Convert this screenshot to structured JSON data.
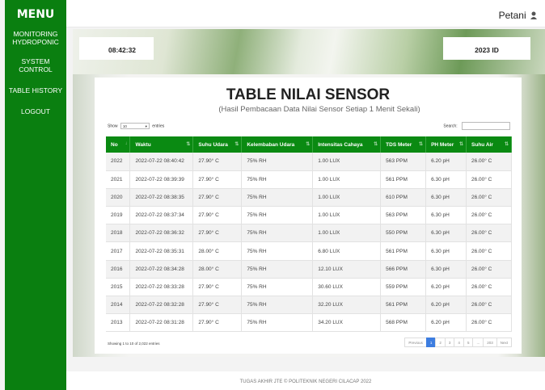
{
  "sidebar": {
    "brand": "MENU",
    "items": [
      {
        "line1": "MONITORING",
        "line2": "HYDROPONIC"
      },
      {
        "line1": "SYSTEM",
        "line2": "CONTROL"
      },
      {
        "line1": "TABLE HISTORY",
        "line2": ""
      },
      {
        "line1": "LOGOUT",
        "line2": ""
      }
    ]
  },
  "topbar": {
    "user": "Petani"
  },
  "hero": {
    "clock": "08:42:32",
    "id_label": "2023 ID"
  },
  "card": {
    "title": "TABLE NILAI SENSOR",
    "subtitle": "(Hasil Pembacaan Data Nilai Sensor Setiap 1 Menit Sekali)"
  },
  "controls": {
    "show_label": "Show",
    "length_value": "10",
    "entries_label": "entries",
    "search_label": "Search:"
  },
  "table": {
    "columns": [
      "No",
      "Waktu",
      "Suhu Udara",
      "Kelembaban Udara",
      "Intensitas Cahaya",
      "TDS Meter",
      "PH Meter",
      "Suhu Air"
    ],
    "rows": [
      [
        "2022",
        "2022-07-22 08:40:42",
        "27.90° C",
        "75% RH",
        "1.00 LUX",
        "563 PPM",
        "6.20 pH",
        "26.00° C"
      ],
      [
        "2021",
        "2022-07-22 08:39:39",
        "27.90° C",
        "75% RH",
        "1.00 LUX",
        "561 PPM",
        "6.30 pH",
        "26.00° C"
      ],
      [
        "2020",
        "2022-07-22 08:38:35",
        "27.90° C",
        "75% RH",
        "1.00 LUX",
        "610 PPM",
        "6.30 pH",
        "26.00° C"
      ],
      [
        "2019",
        "2022-07-22 08:37:34",
        "27.90° C",
        "75% RH",
        "1.00 LUX",
        "563 PPM",
        "6.30 pH",
        "26.00° C"
      ],
      [
        "2018",
        "2022-07-22 08:36:32",
        "27.90° C",
        "75% RH",
        "1.00 LUX",
        "550 PPM",
        "6.30 pH",
        "26.00° C"
      ],
      [
        "2017",
        "2022-07-22 08:35:31",
        "28.00° C",
        "75% RH",
        "6.80 LUX",
        "561 PPM",
        "6.30 pH",
        "26.00° C"
      ],
      [
        "2016",
        "2022-07-22 08:34:28",
        "28.00° C",
        "75% RH",
        "12.10 LUX",
        "566 PPM",
        "6.30 pH",
        "26.00° C"
      ],
      [
        "2015",
        "2022-07-22 08:33:28",
        "27.90° C",
        "75% RH",
        "30.60 LUX",
        "559 PPM",
        "6.20 pH",
        "26.00° C"
      ],
      [
        "2014",
        "2022-07-22 08:32:28",
        "27.90° C",
        "75% RH",
        "32.20 LUX",
        "561 PPM",
        "6.20 pH",
        "26.00° C"
      ],
      [
        "2013",
        "2022-07-22 08:31:28",
        "27.90° C",
        "75% RH",
        "34.20 LUX",
        "568 PPM",
        "6.20 pH",
        "26.00° C"
      ]
    ]
  },
  "pagination": {
    "info": "Showing 1 to 10 of 2,022 entries",
    "previous": "Previous",
    "pages": [
      "1",
      "2",
      "3",
      "4",
      "5",
      "...",
      "203"
    ],
    "next": "Next",
    "active_page": "1"
  },
  "footer": {
    "text": "TUGAS AKHIR JTE © POLITEKNIK NEGERI CILACAP 2022"
  },
  "colors": {
    "sidebar": "#0a7f10",
    "table_header": "#0a8a12",
    "active_page": "#3d7de0"
  }
}
